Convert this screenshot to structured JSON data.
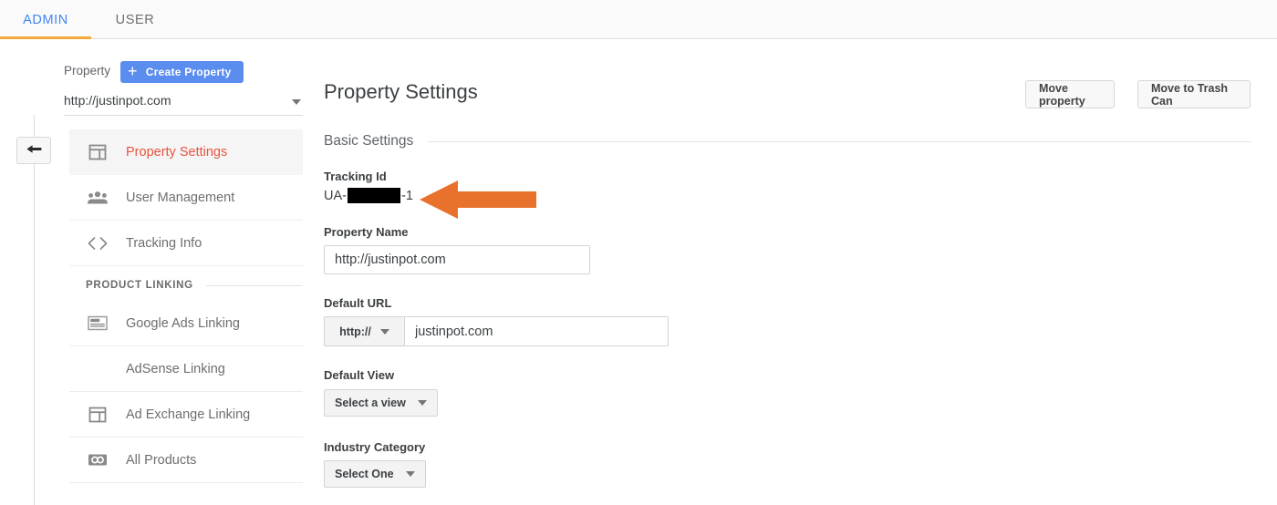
{
  "tabs": [
    {
      "id": "admin",
      "label": "ADMIN",
      "active": true
    },
    {
      "id": "user",
      "label": "USER",
      "active": false
    }
  ],
  "property_selector": {
    "label": "Property",
    "create_button": "Create Property",
    "plus_icon": "plus-icon",
    "selected_value": "http://justinpot.com",
    "dropdown_icon": "chevron-down-icon"
  },
  "back_button": {
    "icon": "back-arrow-icon"
  },
  "sidebar": {
    "items": [
      {
        "label": "Property Settings",
        "icon": "layout-window-icon",
        "active": true
      },
      {
        "label": "User Management",
        "icon": "people-group-icon",
        "active": false
      },
      {
        "label": "Tracking Info",
        "icon": "code-brackets-icon",
        "active": false
      }
    ],
    "group": {
      "title": "PRODUCT LINKING",
      "items": [
        {
          "label": "Google Ads Linking",
          "icon": "ad-card-icon"
        },
        {
          "label": "AdSense Linking",
          "icon": ""
        },
        {
          "label": "Ad Exchange Linking",
          "icon": "layout-window-icon"
        },
        {
          "label": "All Products",
          "icon": "link-chain-icon"
        }
      ]
    }
  },
  "main": {
    "title": "Property Settings",
    "header_buttons": [
      {
        "id": "move-property",
        "label": "Move property"
      },
      {
        "id": "move-trash",
        "label": "Move to Trash Can"
      }
    ],
    "section_title": "Basic Settings",
    "tracking_id": {
      "label": "Tracking Id",
      "prefix": "UA-",
      "redacted": true,
      "suffix": "-1"
    },
    "property_name": {
      "label": "Property Name",
      "value": "http://justinpot.com"
    },
    "default_url": {
      "label": "Default URL",
      "scheme": "http://",
      "scheme_icon": "chevron-down-icon",
      "value": "justinpot.com"
    },
    "default_view": {
      "label": "Default View",
      "value": "Select a view",
      "icon": "chevron-down-icon"
    },
    "industry_category": {
      "label": "Industry Category",
      "value": "Select One",
      "icon": "chevron-down-icon"
    }
  },
  "annotation": {
    "type": "arrow-left",
    "color": "#e8722c",
    "points_at": "tracking-id-value"
  },
  "colors": {
    "tab_active": "#4285f4",
    "tab_underline": "#f4a83a",
    "create_button": "#5b8def",
    "nav_active_text": "#e8543f",
    "nav_active_bg": "#f5f5f5",
    "arrow": "#e8722c"
  }
}
